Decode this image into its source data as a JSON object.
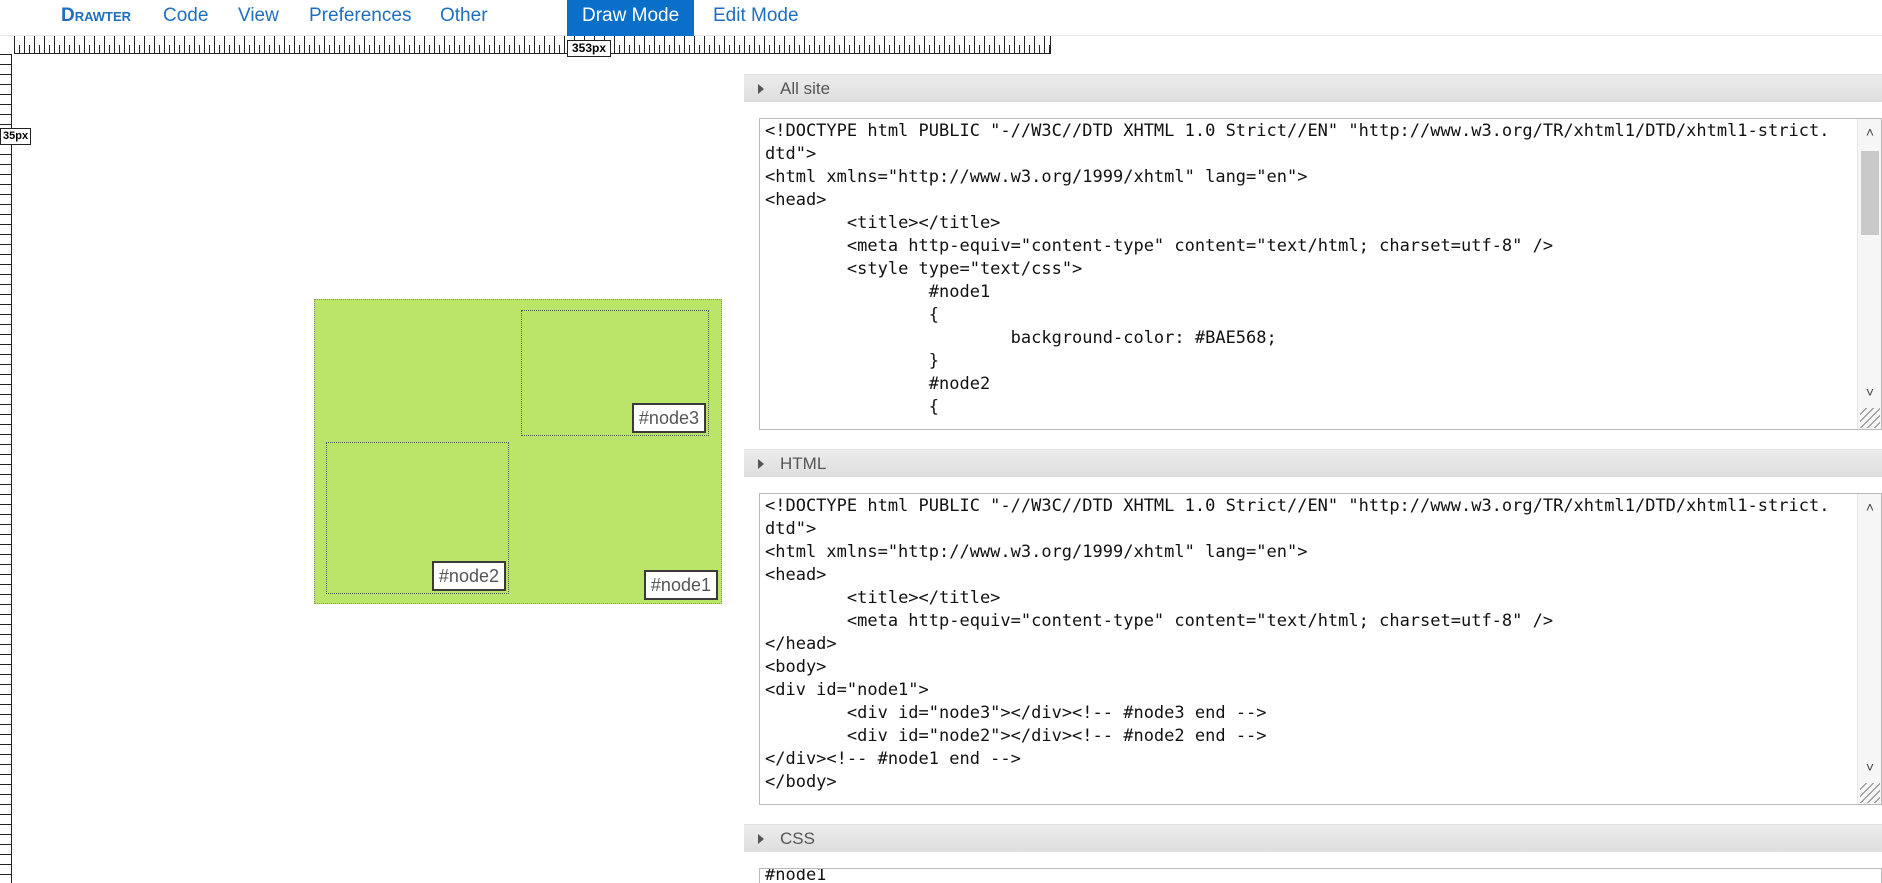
{
  "menu": {
    "brand": "Drawter",
    "code": "Code",
    "view": "View",
    "preferences": "Preferences",
    "other": "Other",
    "draw_mode": "Draw Mode",
    "edit_mode": "Edit Mode"
  },
  "rulers": {
    "horizontal_readout": "353px",
    "vertical_readout": "35px"
  },
  "canvas": {
    "node1_label": "#node1",
    "node2_label": "#node2",
    "node3_label": "#node3",
    "node1_color": "#BAE568"
  },
  "panels": {
    "all_site": {
      "title": "All site",
      "code": "<!DOCTYPE html PUBLIC \"-//W3C//DTD XHTML 1.0 Strict//EN\" \"http://www.w3.org/TR/xhtml1/DTD/xhtml1-strict.dtd\">\n<html xmlns=\"http://www.w3.org/1999/xhtml\" lang=\"en\">\n<head>\n        <title></title>\n        <meta http-equiv=\"content-type\" content=\"text/html; charset=utf-8\" />\n        <style type=\"text/css\">\n                #node1\n                {\n                        background-color: #BAE568;\n                }\n                #node2\n                {"
    },
    "html": {
      "title": "HTML",
      "code": "<!DOCTYPE html PUBLIC \"-//W3C//DTD XHTML 1.0 Strict//EN\" \"http://www.w3.org/TR/xhtml1/DTD/xhtml1-strict.dtd\">\n<html xmlns=\"http://www.w3.org/1999/xhtml\" lang=\"en\">\n<head>\n        <title></title>\n        <meta http-equiv=\"content-type\" content=\"text/html; charset=utf-8\" />\n</head>\n<body>\n<div id=\"node1\">\n        <div id=\"node3\"></div><!-- #node3 end -->\n        <div id=\"node2\"></div><!-- #node2 end -->\n</div><!-- #node1 end -->\n</body>"
    },
    "css": {
      "title": "CSS",
      "code": "#node1"
    }
  }
}
